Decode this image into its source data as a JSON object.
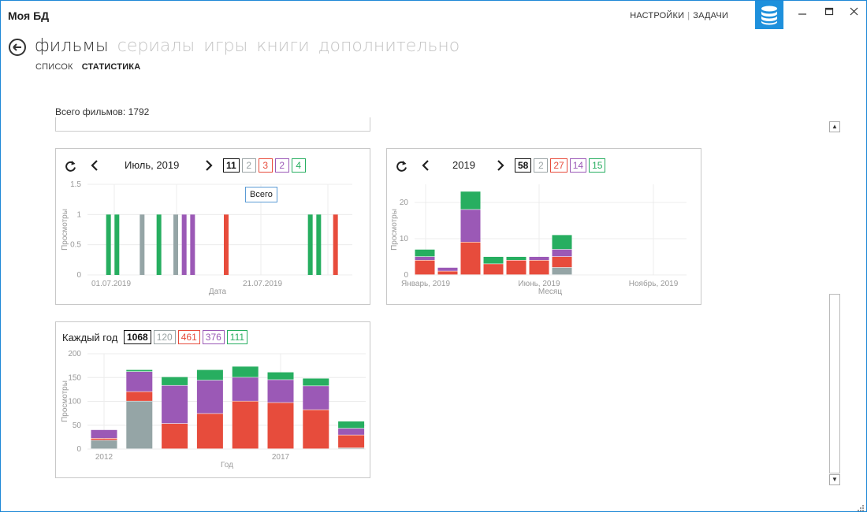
{
  "app": {
    "title": "Моя БД"
  },
  "top_links": {
    "settings": "НАСТРОЙКИ",
    "tasks": "ЗАДАЧИ"
  },
  "icons": {
    "database": "database-icon",
    "back": "back-arrow-icon",
    "refresh": "refresh-icon",
    "minimize": "minimize-icon",
    "maximize": "maximize-icon",
    "close": "close-icon"
  },
  "colors": {
    "accent": "#1e90dc",
    "gray": "#95a5a6",
    "red": "#e74c3c",
    "purple": "#9b59b6",
    "green": "#27ae60"
  },
  "categories": [
    "фильмы",
    "сериалы",
    "игры",
    "книги",
    "дополнительно"
  ],
  "subtabs": [
    "СПИСОК",
    "СТАТИСТИКА"
  ],
  "total_films": "Всего фильмов: 1792",
  "panel_month": {
    "period": "Июль, 2019",
    "badges": {
      "total": "11",
      "gray": "2",
      "red": "3",
      "purple": "2",
      "green": "4"
    },
    "tooltip": "Всего"
  },
  "panel_year": {
    "period": "2019",
    "badges": {
      "total": "58",
      "gray": "2",
      "red": "27",
      "purple": "14",
      "green": "15"
    }
  },
  "panel_all": {
    "title": "Каждый год",
    "badges": {
      "total": "1068",
      "gray": "120",
      "red": "461",
      "purple": "376",
      "green": "111"
    }
  },
  "chart_data": [
    {
      "type": "bar",
      "xlabel": "Дата",
      "ylabel": "Просмотры",
      "ylim": [
        0,
        1.5
      ],
      "yticks": [
        "0",
        "0.5",
        "1",
        "1.5"
      ],
      "xtick_labels": [
        "01.07.2019",
        "21.07.2019"
      ],
      "x": [
        3,
        4,
        7,
        9,
        11,
        12,
        13,
        17,
        27,
        28,
        30
      ],
      "series": [
        {
          "color": "gray",
          "values": [
            0,
            0,
            1,
            0,
            1,
            0,
            0,
            0,
            0,
            0,
            0
          ]
        },
        {
          "color": "red",
          "values": [
            0,
            0,
            0,
            0,
            0,
            0,
            0,
            1,
            0,
            0,
            1
          ]
        },
        {
          "color": "purple",
          "values": [
            0,
            0,
            0,
            0,
            0,
            1,
            1,
            0,
            0,
            0,
            0
          ]
        },
        {
          "color": "green",
          "values": [
            1,
            1,
            0,
            1,
            0,
            0,
            0,
            0,
            1,
            1,
            0
          ]
        }
      ]
    },
    {
      "type": "bar",
      "xlabel": "Месяц",
      "ylabel": "Просмотры",
      "ylim": [
        0,
        25
      ],
      "yticks": [
        "0",
        "10",
        "20"
      ],
      "xtick_labels": [
        "Январь, 2019",
        "Июнь, 2019",
        "Ноябрь, 2019"
      ],
      "categories": [
        1,
        2,
        3,
        4,
        5,
        6,
        7
      ],
      "series": [
        {
          "color": "gray",
          "values": [
            0,
            0,
            0,
            0,
            0,
            0,
            2
          ]
        },
        {
          "color": "red",
          "values": [
            4,
            1,
            9,
            3,
            4,
            4,
            3
          ]
        },
        {
          "color": "purple",
          "values": [
            1,
            1,
            9,
            0,
            0,
            1,
            2
          ]
        },
        {
          "color": "green",
          "values": [
            2,
            0,
            5,
            2,
            1,
            0,
            4
          ]
        }
      ]
    },
    {
      "type": "bar",
      "xlabel": "Год",
      "ylabel": "Просмотры",
      "ylim": [
        0,
        200
      ],
      "yticks": [
        "0",
        "50",
        "100",
        "150",
        "200"
      ],
      "xtick_labels": [
        "2012",
        "2017"
      ],
      "categories": [
        2012,
        2013,
        2014,
        2015,
        2016,
        2017,
        2018,
        2019
      ],
      "series": [
        {
          "color": "gray",
          "values": [
            18,
            100,
            0,
            0,
            0,
            0,
            0,
            2
          ]
        },
        {
          "color": "red",
          "values": [
            4,
            20,
            53,
            74,
            100,
            97,
            82,
            27
          ]
        },
        {
          "color": "purple",
          "values": [
            18,
            42,
            80,
            70,
            50,
            48,
            50,
            14
          ]
        },
        {
          "color": "green",
          "values": [
            1,
            4,
            18,
            22,
            23,
            16,
            16,
            15
          ]
        }
      ]
    }
  ]
}
